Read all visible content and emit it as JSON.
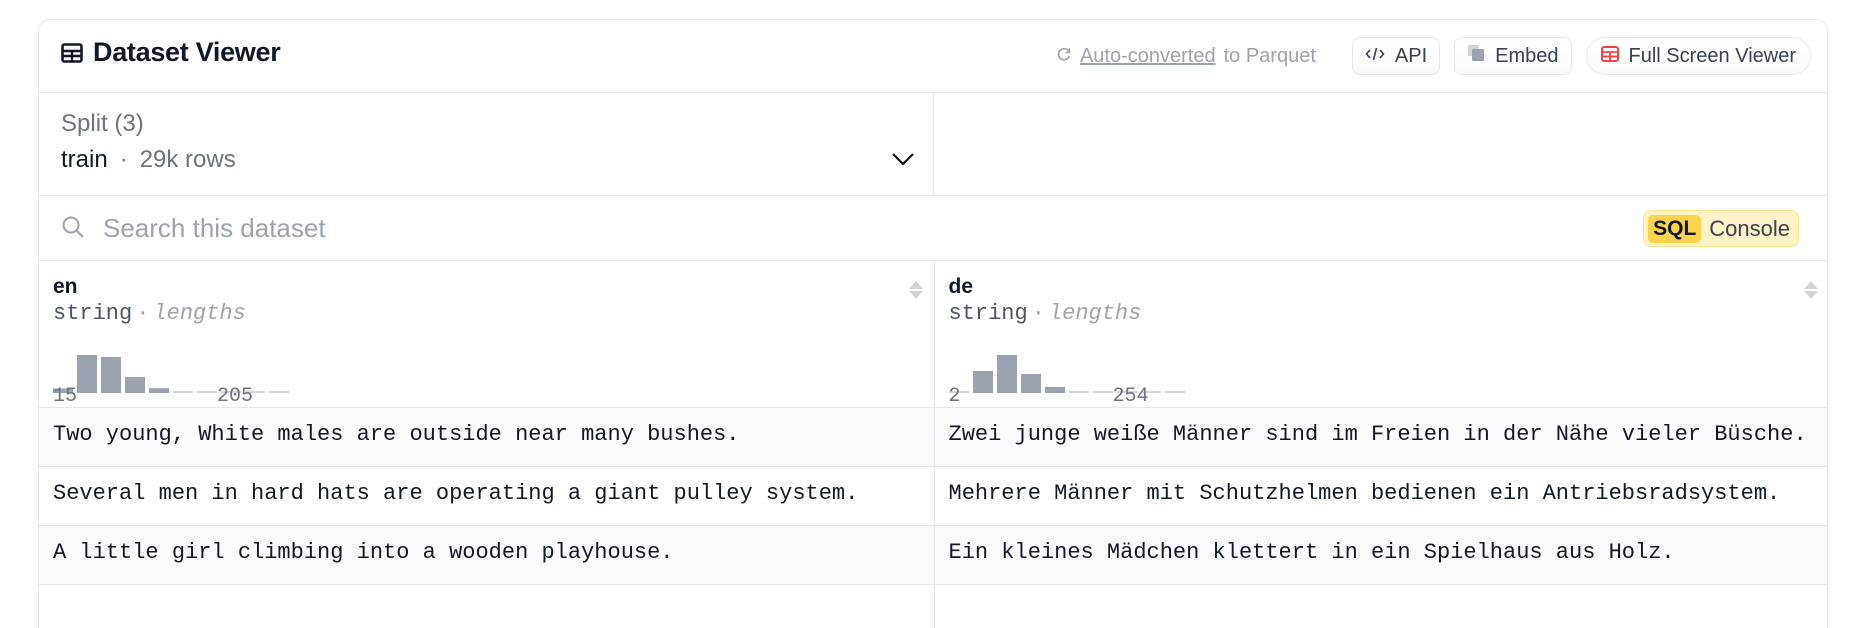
{
  "header": {
    "title": "Dataset Viewer",
    "converted_link": "Auto-converted",
    "converted_suffix": "to Parquet",
    "api_label": "API",
    "embed_label": "Embed",
    "fullscreen_label": "Full Screen Viewer"
  },
  "split": {
    "label": "Split (3)",
    "value": "train",
    "separator": "·",
    "rows": "29k rows"
  },
  "search": {
    "placeholder": "Search this dataset",
    "sql_tag": "SQL",
    "sql_label": "Console"
  },
  "columns": [
    {
      "name": "en",
      "type": "string",
      "separator": "·",
      "stat": "lengths",
      "range_min": "15",
      "range_max": "205",
      "histogram": [
        0.12,
        1.0,
        0.95,
        0.42,
        0.13,
        0.03,
        0.03,
        0.03,
        0.03,
        0.03
      ]
    },
    {
      "name": "de",
      "type": "string",
      "separator": "·",
      "stat": "lengths",
      "range_min": "2",
      "range_max": "254",
      "histogram": [
        0.03,
        0.58,
        1.0,
        0.5,
        0.16,
        0.03,
        0.03,
        0.03,
        0.03,
        0.03
      ]
    }
  ],
  "rows": [
    [
      "Two young, White males are outside near many bushes.",
      "Zwei junge weiße Männer sind im Freien in der Nähe vieler Büsche."
    ],
    [
      "Several men in hard hats are operating a giant pulley system.",
      "Mehrere Männer mit Schutzhelmen bedienen ein Antriebsradsystem."
    ],
    [
      "A little girl climbing into a wooden playhouse.",
      "Ein kleines Mädchen klettert in ein Spielhaus aus Holz."
    ],
    [
      "",
      ""
    ]
  ],
  "colors": {
    "bar": "#9ca3af",
    "bar_empty": "#d1d5db",
    "sql_bg": "#fef3c7",
    "sql_tag": "#fcd34d",
    "fullscreen_icon": "#ef4444"
  }
}
